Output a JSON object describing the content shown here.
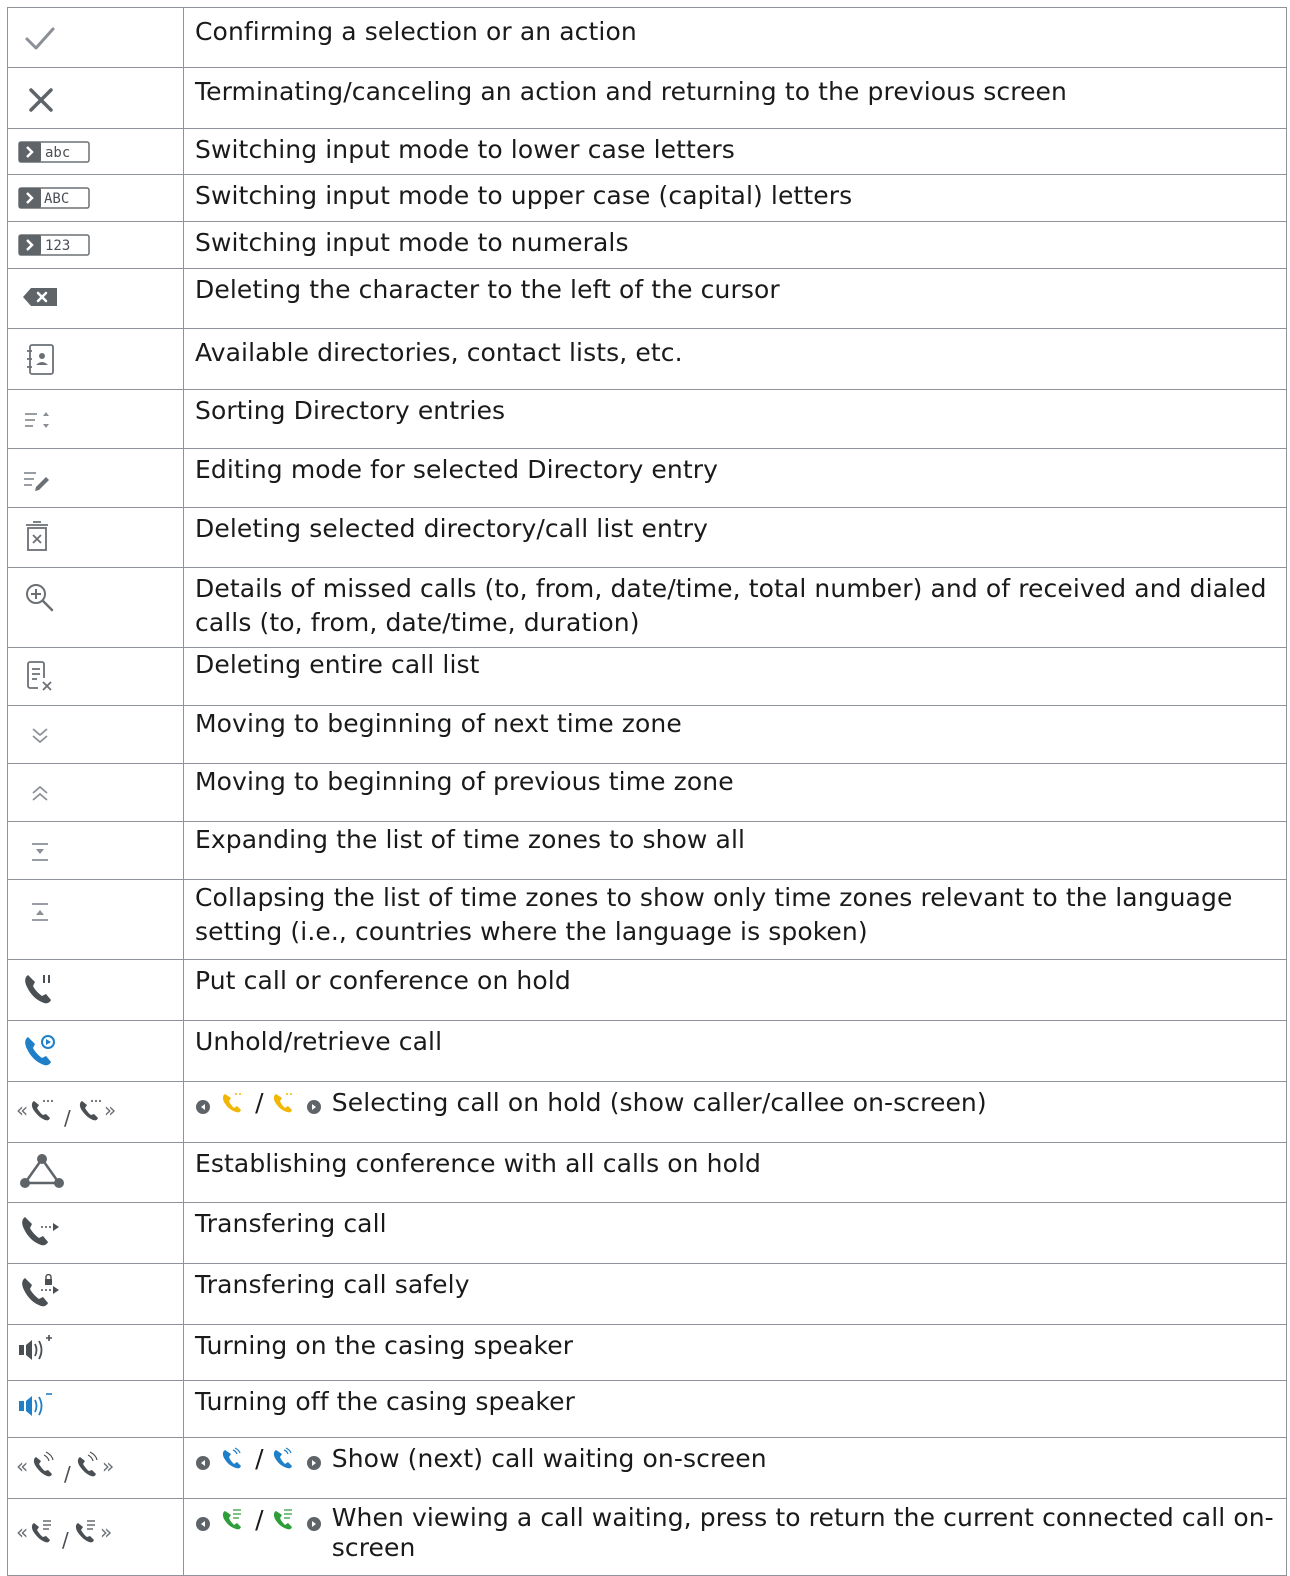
{
  "rows": [
    {
      "icon": "checkmark-icon",
      "text": "Confirming a selection or an action"
    },
    {
      "icon": "close-icon",
      "text": "Terminating/canceling an action and returning to the previous screen"
    },
    {
      "icon": "input-mode-lowercase-icon",
      "icon_label": "abc",
      "text": "Switching input mode to lower case letters"
    },
    {
      "icon": "input-mode-uppercase-icon",
      "icon_label": "ABC",
      "text": "Switching input mode to upper case (capital) letters"
    },
    {
      "icon": "input-mode-numerals-icon",
      "icon_label": "123",
      "text": "Switching input mode to numerals"
    },
    {
      "icon": "backspace-icon",
      "text": "Deleting the character to the left of the cursor"
    },
    {
      "icon": "directory-icon",
      "text": "Available directories, contact lists, etc."
    },
    {
      "icon": "sort-icon",
      "text": "Sorting Directory entries"
    },
    {
      "icon": "edit-entry-icon",
      "text": "Editing mode for selected Directory entry"
    },
    {
      "icon": "trash-icon",
      "text": "Deleting selected directory/call list entry"
    },
    {
      "icon": "zoom-details-icon",
      "text": "Details of missed calls (to, from, date/time, total number) and of received and dialed calls (to, from, date/time, duration)"
    },
    {
      "icon": "delete-list-icon",
      "text": "Deleting entire call list"
    },
    {
      "icon": "chevron-double-down-icon",
      "text": "Moving to beginning of next time zone"
    },
    {
      "icon": "chevron-double-up-icon",
      "text": "Moving to beginning of previous time zone"
    },
    {
      "icon": "expand-list-icon",
      "text": "Expanding the list of time zones to show all"
    },
    {
      "icon": "collapse-list-icon",
      "text": "Collapsing the list of time zones to show only time zones relevant to the language setting (i.e., countries where the language is spoken)"
    },
    {
      "icon": "hold-call-icon",
      "text": "Put call or conference on hold"
    },
    {
      "icon": "unhold-call-icon",
      "text": "Unhold/retrieve call"
    },
    {
      "icon": "select-held-call-icon",
      "text": "Selecting call on hold (show caller/callee on-screen)"
    },
    {
      "icon": "conference-icon",
      "text": "Establishing conference with all calls on hold"
    },
    {
      "icon": "transfer-call-icon",
      "text": "Transfering call"
    },
    {
      "icon": "transfer-call-safe-icon",
      "text": "Transfering call safely"
    },
    {
      "icon": "speaker-on-icon",
      "text": "Turning on the casing speaker"
    },
    {
      "icon": "speaker-off-icon",
      "text": "Turning off the casing speaker"
    },
    {
      "icon": "call-waiting-icon",
      "text": "Show (next) call waiting on-screen"
    },
    {
      "icon": "return-connected-call-icon",
      "text": "When viewing a call waiting, press to return the current connected call on-screen"
    }
  ],
  "colors": {
    "icon_gray": "#8a9096",
    "icon_dark": "#4a4f54",
    "blue": "#1f7fc8",
    "yellow": "#f2b705",
    "green": "#2e9e3b",
    "border": "#8e9499"
  }
}
